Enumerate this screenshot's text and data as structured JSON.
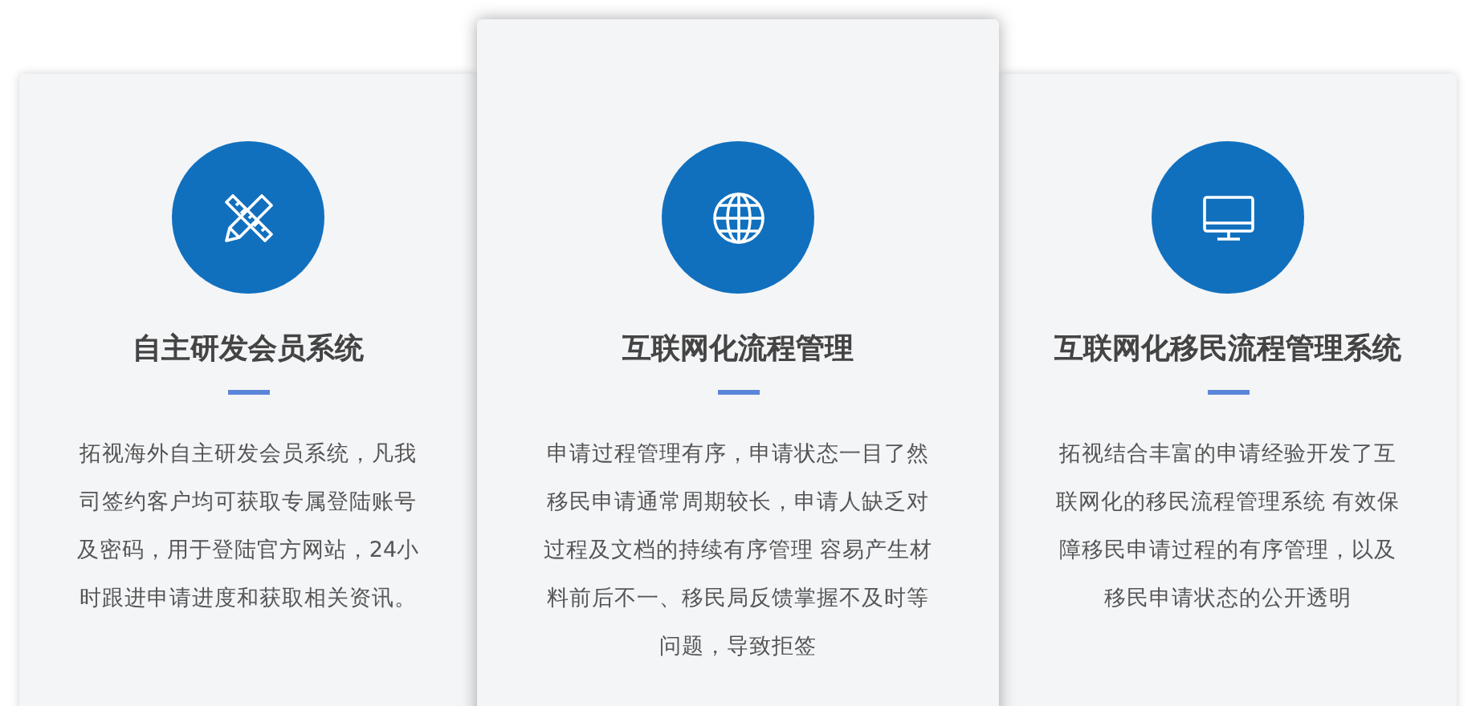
{
  "cards": [
    {
      "kind": "ruler-pencil",
      "raised": false,
      "title": "自主研发会员系统",
      "text": "拓视海外自主研发会员系统，凡我司签约客户均可获取专属登陆账号及密码，用于登陆官方网站，24小时跟进申请进度和获取相关资讯。"
    },
    {
      "kind": "globe",
      "raised": true,
      "title": "互联网化流程管理",
      "text": "申请过程管理有序，申请状态一目了然移民申请通常周期较长，申请人缺乏对过程及文档的持续有序管理 容易产生材料前后不一、移民局反馈掌握不及时等问题，导致拒签"
    },
    {
      "kind": "monitor",
      "raised": false,
      "title": "互联网化移民流程管理系统",
      "text": "拓视结合丰富的申请经验开发了互联网化的移民流程管理系统 有效保障移民申请过程的有序管理，以及移民申请状态的公开透明"
    }
  ]
}
